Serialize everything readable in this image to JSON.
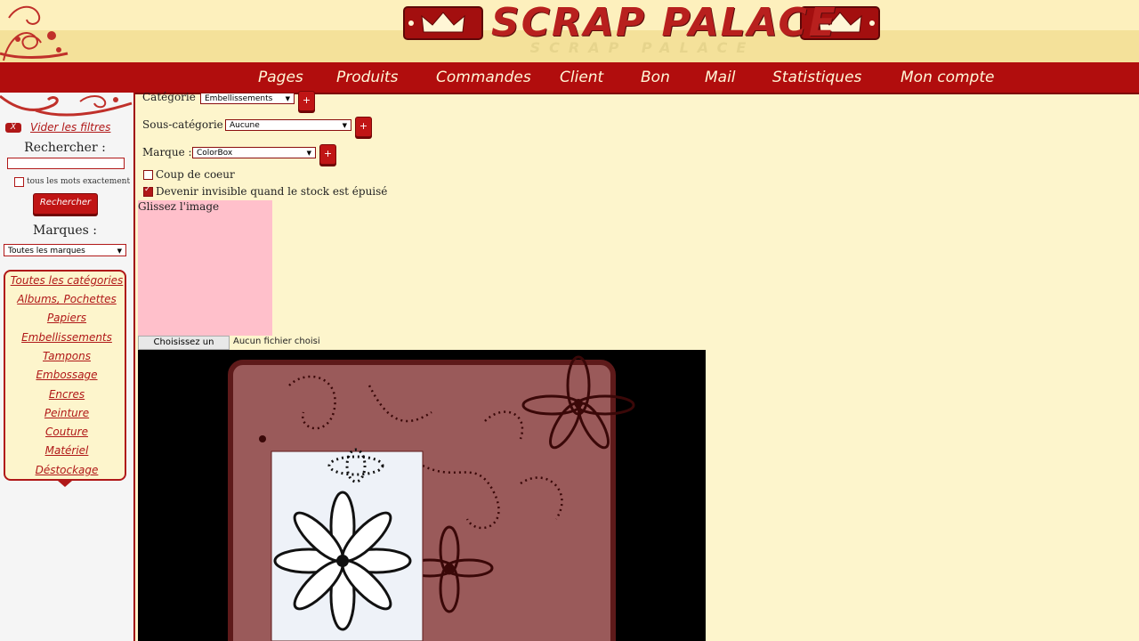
{
  "header": {
    "logo_text": "SCRAP PALACE",
    "logo_reflection": "SCRAP PALACE",
    "colors": {
      "brand_red": "#b10d0d",
      "cream": "#fdf5cc",
      "header_gold": "#fbeaa6"
    }
  },
  "nav": {
    "items": [
      "Pages",
      "Produits",
      "Commandes",
      "Client",
      "Bon",
      "Mail",
      "Statistiques",
      "Mon compte"
    ]
  },
  "sidebar": {
    "clear_badge": "X",
    "clear_filters": "Vider les filtres",
    "search_label": "Rechercher :",
    "search_value": "",
    "exact_label": "tous les mots exactement",
    "search_button": "Rechercher",
    "brands_label": "Marques :",
    "brand_selected": "Toutes les marques",
    "categories": [
      "Toutes les catégories",
      "Albums, Pochettes",
      "Papiers",
      "Embellissements",
      "Tampons",
      "Embossage",
      "Encres",
      "Peinture",
      "Couture",
      "Matériel",
      "Déstockage"
    ]
  },
  "form": {
    "category_label": "Catégorie :",
    "category_value": "Embellissements",
    "subcategory_label": "Sous-catégorie :",
    "subcategory_value": "Aucune",
    "brand_label": "Marque :",
    "brand_value": "ColorBox",
    "plus_label": "+",
    "favorite_label": "Coup de coeur",
    "favorite_checked": false,
    "invisible_label": "Devenir invisible quand le stock est épuisé",
    "invisible_checked": true,
    "drop_label": "Glissez l'image",
    "file_button": "Choisissez un fichier",
    "file_status": "Aucun fichier choisi"
  },
  "preview": {
    "background": "#000000",
    "frame_color": "#9a5a5a",
    "inner_color": "#eef2f8"
  }
}
